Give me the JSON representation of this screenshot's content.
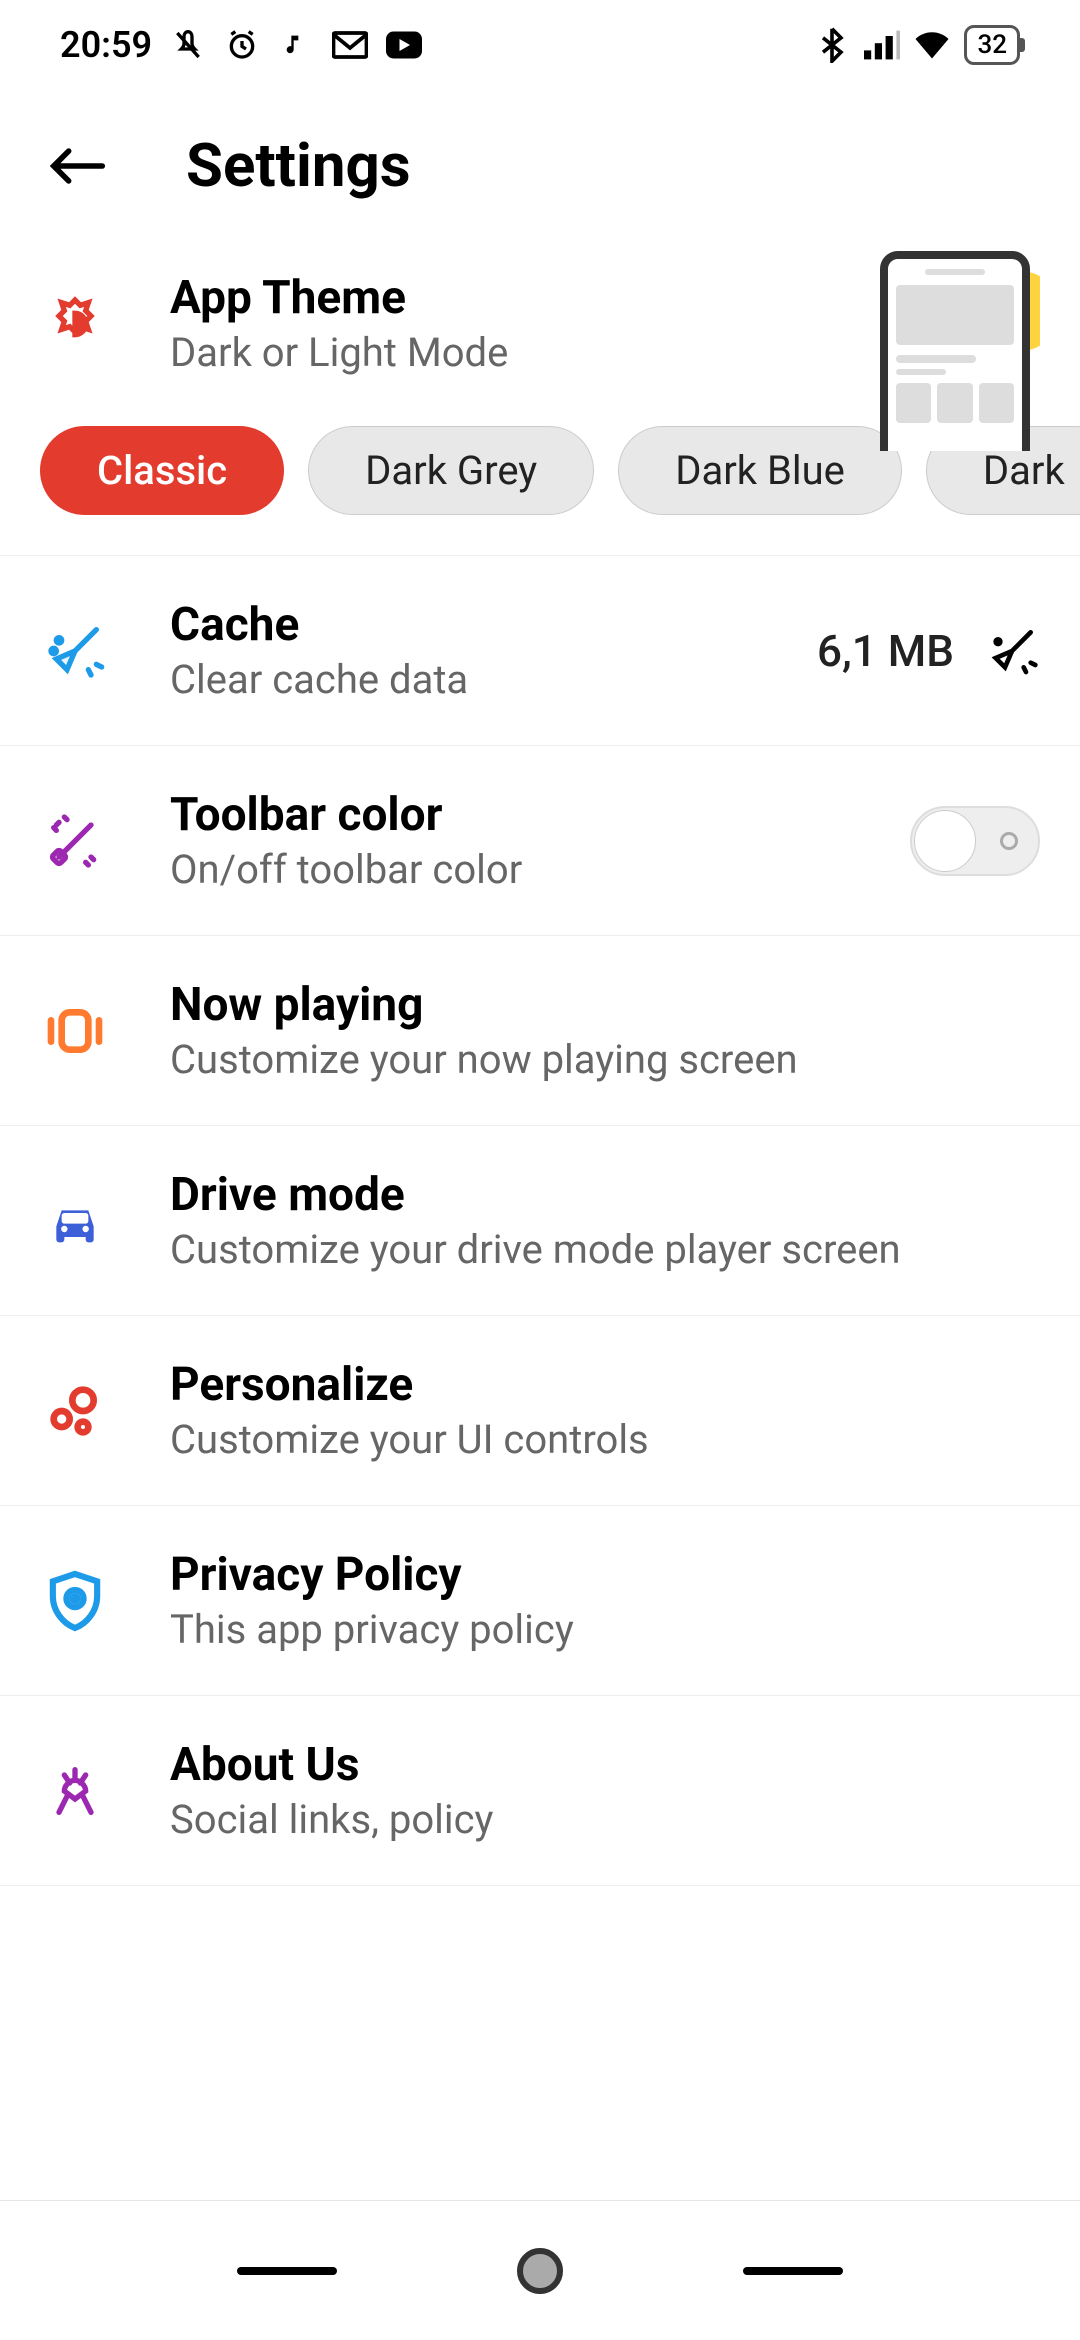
{
  "status": {
    "time": "20:59",
    "battery": "32"
  },
  "header": {
    "title": "Settings"
  },
  "theme": {
    "title": "App Theme",
    "subtitle": "Dark or Light Mode",
    "chips": [
      "Classic",
      "Dark Grey",
      "Dark Blue",
      "Dark"
    ],
    "active_index": 0
  },
  "rows": {
    "cache": {
      "title": "Cache",
      "subtitle": "Clear cache data",
      "size": "6,1 MB"
    },
    "toolbar": {
      "title": "Toolbar color",
      "subtitle": "On/off toolbar color",
      "enabled": false
    },
    "nowplaying": {
      "title": "Now playing",
      "subtitle": "Customize your now playing screen"
    },
    "drive": {
      "title": "Drive mode",
      "subtitle": "Customize your drive mode player screen"
    },
    "personalize": {
      "title": "Personalize",
      "subtitle": "Customize your UI controls"
    },
    "privacy": {
      "title": "Privacy Policy",
      "subtitle": "This app privacy policy"
    },
    "about": {
      "title": "About Us",
      "subtitle": "Social links, policy"
    }
  }
}
